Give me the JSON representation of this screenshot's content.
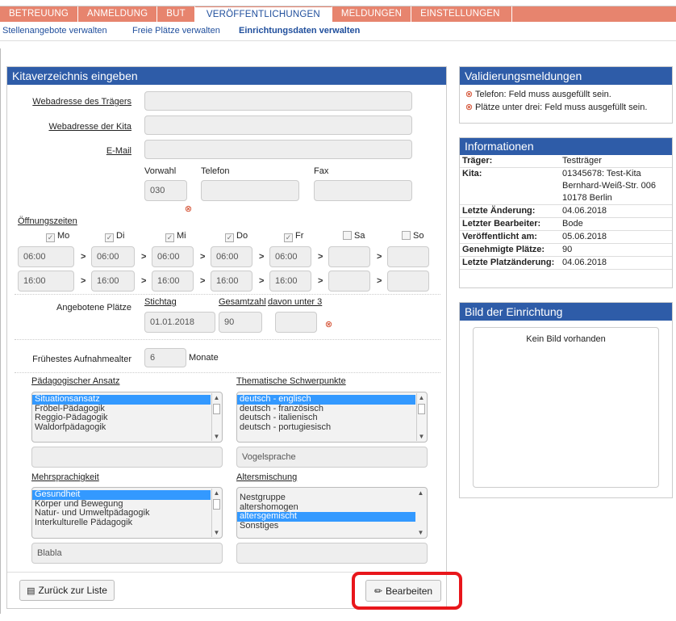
{
  "nav": {
    "tabs": [
      "BETREUUNG",
      "ANMELDUNG",
      "BUT",
      "VERÖFFENTLICHUNGEN",
      "MELDUNGEN",
      "EINSTELLUNGEN"
    ],
    "active_tab": "VERÖFFENTLICHUNGEN"
  },
  "subnav": {
    "items": [
      "Stellenangebote verwalten",
      "Freie Plätze verwalten",
      "Einrichtungsdaten verwalten"
    ],
    "active": "Einrichtungsdaten verwalten"
  },
  "form": {
    "title": "Kitaverzeichnis eingeben",
    "traeger_url_label": "Webadresse des Trägers",
    "traeger_url_value": "",
    "kita_url_label": "Webadresse der Kita",
    "kita_url_value": "",
    "email_label": "E-Mail",
    "email_value": "",
    "vorwahl_label": "Vorwahl",
    "vorwahl_value": "030",
    "telefon_label": "Telefon",
    "telefon_value": "",
    "fax_label": "Fax",
    "fax_value": "",
    "oeffnungszeiten_label": "Öffnungszeiten",
    "days": [
      {
        "label": "Mo",
        "checked": true,
        "from": "06:00",
        "to": "16:00"
      },
      {
        "label": "Di",
        "checked": true,
        "from": "06:00",
        "to": "16:00"
      },
      {
        "label": "Mi",
        "checked": true,
        "from": "06:00",
        "to": "16:00"
      },
      {
        "label": "Do",
        "checked": true,
        "from": "06:00",
        "to": "16:00"
      },
      {
        "label": "Fr",
        "checked": true,
        "from": "06:00",
        "to": "16:00"
      },
      {
        "label": "Sa",
        "checked": false,
        "from": "",
        "to": ""
      },
      {
        "label": "So",
        "checked": false,
        "from": "",
        "to": ""
      }
    ],
    "arrow": ">",
    "plaetze_label": "Angebotene Plätze",
    "stichtag_label": "Stichtag",
    "stichtag_value": "01.01.2018",
    "gesamtzahl_label": "Gesamtzahl",
    "gesamtzahl_value": "90",
    "unter3_label": "davon unter 3",
    "unter3_value": "",
    "aufnahmealter_label": "Frühestes Aufnahmealter",
    "aufnahmealter_value": "6",
    "aufnahmealter_unit": "Monate",
    "paedagogik": {
      "label": "Pädagogischer Ansatz",
      "items": [
        {
          "text": "Situationsansatz",
          "selected": true
        },
        {
          "text": "Fröbel-Pädagogik",
          "selected": false
        },
        {
          "text": "Reggio-Pädagogik",
          "selected": false
        },
        {
          "text": "Waldorfpädagogik",
          "selected": false
        }
      ],
      "extra_value": ""
    },
    "schwerpunkte": {
      "label": "Thematische Schwerpunkte",
      "items": [
        {
          "text": "deutsch - englisch",
          "selected": true
        },
        {
          "text": "deutsch - französisch",
          "selected": false
        },
        {
          "text": "deutsch - italienisch",
          "selected": false
        },
        {
          "text": "deutsch - portugiesisch",
          "selected": false
        }
      ],
      "extra_value": "Vogelsprache"
    },
    "mehrsprachigkeit": {
      "label": "Mehrsprachigkeit",
      "items": [
        {
          "text": "Gesundheit",
          "selected": true
        },
        {
          "text": "Körper und Bewegung",
          "selected": false
        },
        {
          "text": "Natur- und Umweltpädagogik",
          "selected": false
        },
        {
          "text": "Interkulturelle Pädagogik",
          "selected": false
        }
      ],
      "extra_value": "Blabla"
    },
    "altersmischung": {
      "label": "Altersmischung",
      "items": [
        {
          "text": "",
          "selected": false
        },
        {
          "text": "Nestgruppe",
          "selected": false
        },
        {
          "text": "altershomogen",
          "selected": false
        },
        {
          "text": "altersgemischt",
          "selected": true
        },
        {
          "text": "Sonstiges",
          "selected": false
        }
      ],
      "extra_value": ""
    },
    "back_button": "Zurück zur Liste",
    "edit_button": "Bearbeiten"
  },
  "validation": {
    "title": "Validierungsmeldungen",
    "messages": [
      "Telefon: Feld muss ausgefüllt sein.",
      "Plätze unter drei: Feld muss ausgefüllt sein."
    ]
  },
  "info": {
    "title": "Informationen",
    "rows": [
      {
        "key": "Träger:",
        "value": "Testträger"
      },
      {
        "key": "Kita:",
        "value": "01345678: Test-Kita"
      },
      {
        "key": "",
        "value": "Bernhard-Weiß-Str. 006"
      },
      {
        "key": "",
        "value": "10178 Berlin"
      },
      {
        "key": "Letzte Änderung:",
        "value": "04.06.2018"
      },
      {
        "key": "Letzter Bearbeiter:",
        "value": "Bode"
      },
      {
        "key": "Veröffentlicht am:",
        "value": "05.06.2018"
      },
      {
        "key": "Genehmigte Plätze:",
        "value": "90"
      },
      {
        "key": "Letzte Platzänderung:",
        "value": "04.06.2018"
      }
    ]
  },
  "bild": {
    "title": "Bild der Einrichtung",
    "empty_text": "Kein Bild vorhanden"
  },
  "colors": {
    "nav_bg": "#e7846e",
    "panel_header": "#2e5ca8",
    "link": "#1f4e9c",
    "selection": "#3399ff",
    "highlight_border": "#e8161b"
  }
}
